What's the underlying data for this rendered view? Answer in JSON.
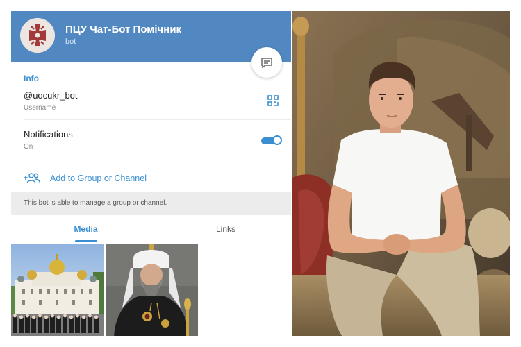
{
  "profile": {
    "bot_name": "ПЦУ Чат-Бот Помічник",
    "bot_subtitle": "bot"
  },
  "info": {
    "section_title": "Info",
    "username_value": "@uocukr_bot",
    "username_label": "Username",
    "notifications_title": "Notifications",
    "notifications_state": "On",
    "notifications_enabled": true
  },
  "actions": {
    "add_to_group_label": "Add to Group or Channel",
    "hint": "This bot is able to manage a group or channel."
  },
  "tabs": [
    {
      "label": "Media",
      "active": true
    },
    {
      "label": "Links",
      "active": false
    }
  ],
  "icons": {
    "message": "message-icon",
    "qr": "qr-code-icon",
    "add_group": "add-group-icon",
    "avatar": "cross-emblem-icon"
  },
  "colors": {
    "header": "#5288c1",
    "accent": "#3a8fd2",
    "panel_bg": "#ececec",
    "emblem": "#a23a3a"
  }
}
